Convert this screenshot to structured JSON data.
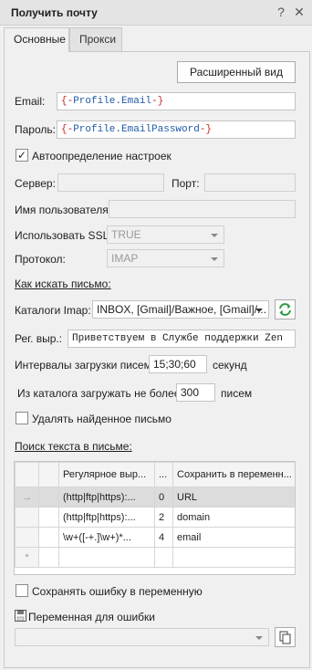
{
  "window": {
    "title": "Получить почту",
    "help_glyph": "?",
    "close_glyph": "✕"
  },
  "tabs": [
    {
      "label": "Основные"
    },
    {
      "label": "Прокси"
    }
  ],
  "advanced_button": "Расширенный вид",
  "email": {
    "label": "Email:",
    "open": "{-",
    "token": "Profile.Email",
    "close": "-}"
  },
  "password": {
    "label": "Пароль:",
    "open": "{-",
    "token": "Profile.EmailPassword",
    "close": "-}"
  },
  "autodetect": {
    "label": "Автоопределение настроек",
    "checked": true,
    "mark": "✓"
  },
  "server": {
    "label": "Сервер:",
    "value": ""
  },
  "port": {
    "label": "Порт:",
    "value": ""
  },
  "username": {
    "label": "Имя пользователя:",
    "value": ""
  },
  "ssl": {
    "label": "Использовать SSL:",
    "value": "TRUE"
  },
  "protocol": {
    "label": "Протокол:",
    "value": "IMAP"
  },
  "search_section": "Как искать письмо:",
  "imap_folders": {
    "label": "Каталоги Imap:",
    "value": "INBOX, [Gmail]/Важное, [Gmail]/..."
  },
  "regex": {
    "label": "Рег. выр.:",
    "value": "Приветствуем в Службе поддержки Zen"
  },
  "intervals": {
    "label": "Интервалы загрузки писем:",
    "value": "15;30;60",
    "unit": "секунд"
  },
  "load_limit": {
    "label": "Из каталога загружать не более",
    "value": "300",
    "unit": "писем"
  },
  "delete_found": {
    "label": "Удалять найденное письмо",
    "checked": false
  },
  "text_search_section": "Поиск текста в письме:",
  "grid": {
    "headers": [
      "Регулярное выр...",
      "...",
      "Сохранить в переменн..."
    ],
    "current_row_marker": "→",
    "new_row_marker": "*",
    "rows": [
      {
        "regex": "(http|ftp|https):...",
        "index": "0",
        "var": "URL"
      },
      {
        "regex": "(http|ftp|https):...",
        "index": "2",
        "var": "domain"
      },
      {
        "regex": "\\w+([-+.]\\w+)*...",
        "index": "4",
        "var": "email"
      }
    ]
  },
  "save_error": {
    "label": "Сохранять ошибку в переменную",
    "checked": false
  },
  "error_var": {
    "label": "Переменная для ошибки",
    "value": ""
  }
}
